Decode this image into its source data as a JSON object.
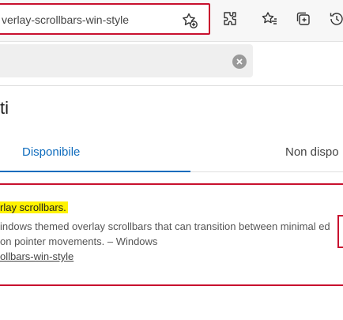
{
  "toolbar": {
    "address_text": "verlay-scrollbars-win-style",
    "icons": [
      "add-favorite-icon",
      "extensions-icon",
      "favorites-icon",
      "collections-icon",
      "history-icon"
    ]
  },
  "search": {
    "value": "",
    "clear_icon": "clear-icon"
  },
  "page": {
    "title": "ti"
  },
  "tabs": [
    {
      "label": "Disponibile",
      "active": true
    },
    {
      "label": "Non dispo",
      "active": false
    }
  ],
  "flag": {
    "title": "rlay scrollbars.",
    "description": "indows themed overlay scrollbars that can transition between minimal ed on pointer movements. – Windows",
    "link": "ollbars-win-style"
  },
  "colors": {
    "accent": "#0f6cbd",
    "highlight": "#fff200",
    "annotation_box": "#c8102e"
  }
}
